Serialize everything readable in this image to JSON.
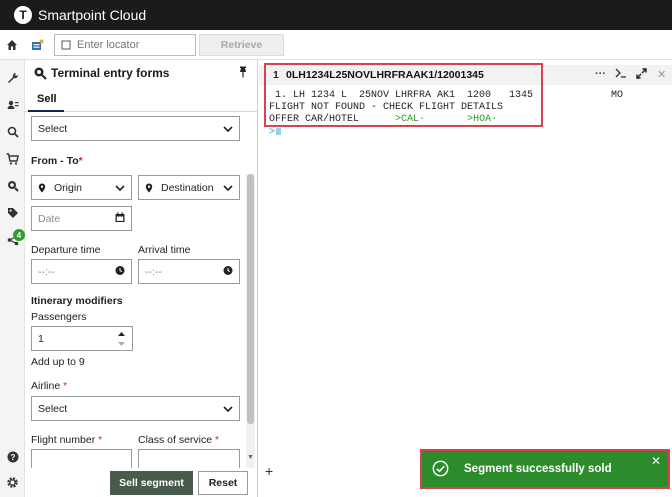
{
  "app": {
    "name": "Smartpoint Cloud",
    "logo_letter": "T"
  },
  "toolbar": {
    "locator_placeholder": "Enter locator",
    "retrieve_label": "Retrieve"
  },
  "rail": {
    "share_badge": "4"
  },
  "panel": {
    "title": "Terminal entry forms",
    "tab": "Sell",
    "select_top": "Select",
    "from_to_label": "From - To",
    "required_mark": "*",
    "origin": "Origin",
    "destination": "Destination",
    "date_placeholder": "Date",
    "departure_time_label": "Departure time",
    "arrival_time_label": "Arrival time",
    "time_placeholder": "--:--",
    "itinerary_modifiers": "Itinerary modifiers",
    "passengers_label": "Passengers",
    "passengers_value": "1",
    "passengers_hint": "Add up to 9",
    "airline_label": "Airline",
    "airline_select": "Select",
    "flight_number_label": "Flight number",
    "class_of_service_label": "Class of service",
    "sell_button": "Sell segment",
    "reset_button": "Reset"
  },
  "terminal": {
    "tab_number": "1",
    "tab_title": "0LH1234L25NOVLHRFRAAK1/12001345",
    "line1": " 1. LH 1234 L  25NOV LHRFRA AK1  1200   1345             MO",
    "line2": "FLIGHT NOT FOUND - CHECK FLIGHT DETAILS",
    "line3_prefix": "OFFER CAR/HOTEL      ",
    "line3_link1": ">CAL·",
    "line3_mid": "       ",
    "line3_link2": ">HOA·",
    "prompt": ">"
  },
  "toast": {
    "message": "Segment successfully sold"
  },
  "colors": {
    "success": "#2c8c2c",
    "highlight": "#d9414e",
    "topbar": "#1b1b1b"
  }
}
